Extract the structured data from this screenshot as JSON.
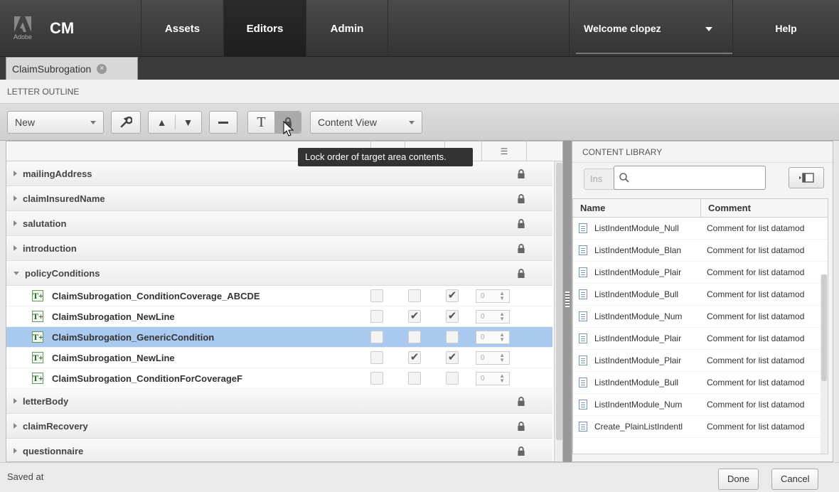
{
  "nav": {
    "adobe_label": "Adobe",
    "app_title": "CM",
    "tabs": [
      {
        "label": "Assets"
      },
      {
        "label": "Editors"
      },
      {
        "label": "Admin"
      }
    ],
    "active_tab": "Editors",
    "welcome": "Welcome clopez",
    "help": "Help"
  },
  "document_tab": {
    "label": "ClaimSubrogation"
  },
  "section_title": "LETTER OUTLINE",
  "toolbar": {
    "new_select": "New",
    "view_select": "Content View",
    "t_label": "T"
  },
  "tooltip": "Lock order of target area contents.",
  "tree": {
    "sections": [
      {
        "name": "mailingAddress"
      },
      {
        "name": "claimInsuredName"
      },
      {
        "name": "salutation"
      },
      {
        "name": "introduction"
      },
      {
        "name": "policyConditions"
      }
    ],
    "children": [
      {
        "name": "ClaimSubrogation_ConditionCoverage_ABCDE",
        "checks": [
          false,
          false,
          true
        ],
        "value": "0",
        "selected": false
      },
      {
        "name": "ClaimSubrogation_NewLine",
        "checks": [
          false,
          true,
          true
        ],
        "value": "0",
        "selected": false
      },
      {
        "name": "ClaimSubrogation_GenericCondition",
        "checks": [
          false,
          false,
          false
        ],
        "value": "0",
        "selected": true
      },
      {
        "name": "ClaimSubrogation_NewLine",
        "checks": [
          false,
          true,
          true
        ],
        "value": "0",
        "selected": false
      },
      {
        "name": "ClaimSubrogation_ConditionForCoverageF",
        "checks": [
          false,
          false,
          false
        ],
        "value": "0",
        "selected": false
      }
    ],
    "sections_after": [
      {
        "name": "letterBody"
      },
      {
        "name": "claimRecovery"
      },
      {
        "name": "questionnaire"
      }
    ],
    "child_icon_label": "T+"
  },
  "library": {
    "title": "CONTENT LIBRARY",
    "insert_label": "Ins",
    "search_placeholder": "",
    "columns": [
      "Name",
      "Comment"
    ],
    "rows": [
      {
        "name": "ListIndentModule_Null",
        "comment": "Comment for list datamod"
      },
      {
        "name": "ListIndentModule_Blan",
        "comment": "Comment for list datamod"
      },
      {
        "name": "ListIndentModule_Plair",
        "comment": "Comment for list datamod"
      },
      {
        "name": "ListIndentModule_Bull",
        "comment": "Comment for list datamod"
      },
      {
        "name": "ListIndentModule_Num",
        "comment": "Comment for list datamod"
      },
      {
        "name": "ListIndentModule_Plair",
        "comment": "Comment for list datamod"
      },
      {
        "name": "ListIndentModule_Plair",
        "comment": "Comment for list datamod"
      },
      {
        "name": "ListIndentModule_Bull",
        "comment": "Comment for list datamod"
      },
      {
        "name": "ListIndentModule_Num",
        "comment": "Comment for list datamod"
      },
      {
        "name": "Create_PlainListIndentl",
        "comment": "Comment for list datamod"
      }
    ]
  },
  "footer": {
    "saved": "Saved at",
    "done": "Done",
    "cancel": "Cancel"
  }
}
